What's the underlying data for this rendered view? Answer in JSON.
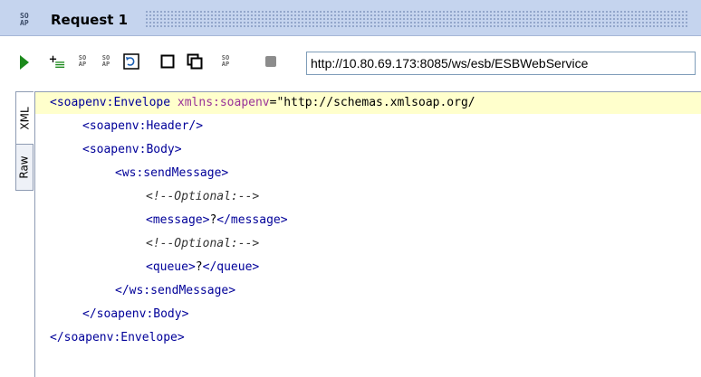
{
  "window": {
    "title": "Request 1",
    "icon_label": "SO\nAP"
  },
  "toolbar": {
    "buttons": [
      {
        "name": "submit-request-button",
        "icon": "play-icon"
      },
      {
        "name": "add-header-button",
        "icon": "add-icon"
      },
      {
        "name": "soap-button-1",
        "icon": "soap-icon"
      },
      {
        "name": "soap-button-2",
        "icon": "soap-icon"
      },
      {
        "name": "refresh-button",
        "icon": "refresh-icon"
      },
      {
        "name": "maximize-button",
        "icon": "square-icon"
      },
      {
        "name": "restore-button",
        "icon": "windows-icon"
      },
      {
        "name": "soap-button-3",
        "icon": "soap-icon"
      },
      {
        "name": "stop-button",
        "icon": "stop-icon"
      }
    ],
    "url": "http://10.80.69.173:8085/ws/esb/ESBWebService"
  },
  "side_tabs": {
    "xml": "XML",
    "raw": "Raw"
  },
  "editor": {
    "line1_open": "<soapenv:Envelope ",
    "line1_attr": "xmlns:soapenv",
    "line1_eq": "=",
    "line1_val": "\"http://schemas.xmlsoap.org/",
    "line2": "<soapenv:Header/>",
    "line3": "<soapenv:Body>",
    "line4": "<ws:sendMessage>",
    "line5": "<!--Optional:-->",
    "line6_open": "<message>",
    "line6_val": "?",
    "line6_close": "</message>",
    "line7": "<!--Optional:-->",
    "line8_open": "<queue>",
    "line8_val": "?",
    "line8_close": "</queue>",
    "line9": "</ws:sendMessage>",
    "line10": "</soapenv:Body>",
    "line11": "</soapenv:Envelope>"
  },
  "colors": {
    "tag": "#000099",
    "attribute": "#993399",
    "highlight_line": "#ffffcc",
    "titlebar": "#c5d4ee"
  }
}
